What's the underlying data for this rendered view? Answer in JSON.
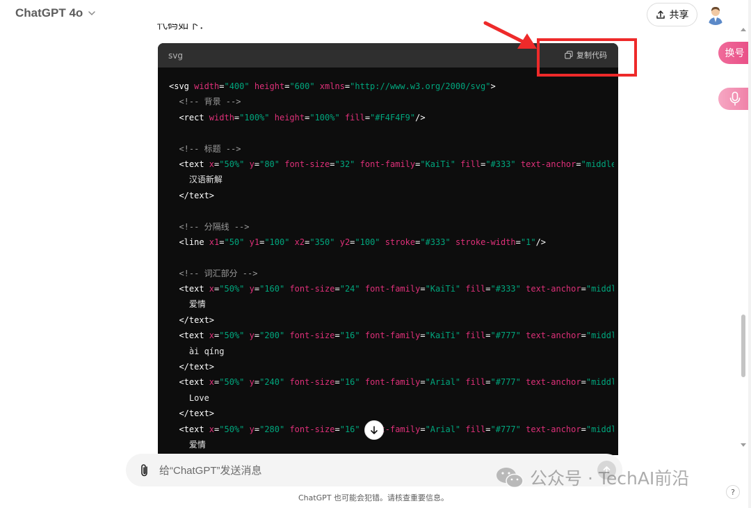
{
  "header": {
    "model_name": "ChatGPT 4o",
    "share_label": "共享"
  },
  "message": {
    "cut_text": "代码如下："
  },
  "code_block": {
    "language": "svg",
    "copy_label": "复制代码",
    "lines": [
      [
        {
          "c": "t-tag",
          "t": "<svg "
        },
        {
          "c": "t-attr",
          "t": "width"
        },
        {
          "c": "t-tag",
          "t": "="
        },
        {
          "c": "t-val",
          "t": "\"400\""
        },
        {
          "c": "t-tag",
          "t": " "
        },
        {
          "c": "t-attr",
          "t": "height"
        },
        {
          "c": "t-tag",
          "t": "="
        },
        {
          "c": "t-val",
          "t": "\"600\""
        },
        {
          "c": "t-tag",
          "t": " "
        },
        {
          "c": "t-attr",
          "t": "xmlns"
        },
        {
          "c": "t-tag",
          "t": "="
        },
        {
          "c": "t-val",
          "t": "\"http://www.w3.org/2000/svg\""
        },
        {
          "c": "t-tag",
          "t": ">"
        }
      ],
      [
        {
          "c": "t-com",
          "t": "  <!-- 背景 -->"
        }
      ],
      [
        {
          "c": "t-tag",
          "t": "  <rect "
        },
        {
          "c": "t-attr",
          "t": "width"
        },
        {
          "c": "t-tag",
          "t": "="
        },
        {
          "c": "t-val",
          "t": "\"100%\""
        },
        {
          "c": "t-tag",
          "t": " "
        },
        {
          "c": "t-attr",
          "t": "height"
        },
        {
          "c": "t-tag",
          "t": "="
        },
        {
          "c": "t-val",
          "t": "\"100%\""
        },
        {
          "c": "t-tag",
          "t": " "
        },
        {
          "c": "t-attr",
          "t": "fill"
        },
        {
          "c": "t-tag",
          "t": "="
        },
        {
          "c": "t-val",
          "t": "\"#F4F4F9\""
        },
        {
          "c": "t-tag",
          "t": "/>"
        }
      ],
      [
        {
          "c": "t-txt",
          "t": ""
        }
      ],
      [
        {
          "c": "t-com",
          "t": "  <!-- 标题 -->"
        }
      ],
      [
        {
          "c": "t-tag",
          "t": "  <text "
        },
        {
          "c": "t-attr",
          "t": "x"
        },
        {
          "c": "t-tag",
          "t": "="
        },
        {
          "c": "t-val",
          "t": "\"50%\""
        },
        {
          "c": "t-tag",
          "t": " "
        },
        {
          "c": "t-attr",
          "t": "y"
        },
        {
          "c": "t-tag",
          "t": "="
        },
        {
          "c": "t-val",
          "t": "\"80\""
        },
        {
          "c": "t-tag",
          "t": " "
        },
        {
          "c": "t-attr",
          "t": "font-size"
        },
        {
          "c": "t-tag",
          "t": "="
        },
        {
          "c": "t-val",
          "t": "\"32\""
        },
        {
          "c": "t-tag",
          "t": " "
        },
        {
          "c": "t-attr",
          "t": "font-family"
        },
        {
          "c": "t-tag",
          "t": "="
        },
        {
          "c": "t-val",
          "t": "\"KaiTi\""
        },
        {
          "c": "t-tag",
          "t": " "
        },
        {
          "c": "t-attr",
          "t": "fill"
        },
        {
          "c": "t-tag",
          "t": "="
        },
        {
          "c": "t-val",
          "t": "\"#333\""
        },
        {
          "c": "t-tag",
          "t": " "
        },
        {
          "c": "t-attr",
          "t": "text-anchor"
        },
        {
          "c": "t-tag",
          "t": "="
        },
        {
          "c": "t-val",
          "t": "\"middle\""
        },
        {
          "c": "t-tag",
          "t": ">"
        }
      ],
      [
        {
          "c": "t-txt",
          "t": "    汉语新解"
        }
      ],
      [
        {
          "c": "t-tag",
          "t": "  </text>"
        }
      ],
      [
        {
          "c": "t-txt",
          "t": ""
        }
      ],
      [
        {
          "c": "t-com",
          "t": "  <!-- 分隔线 -->"
        }
      ],
      [
        {
          "c": "t-tag",
          "t": "  <line "
        },
        {
          "c": "t-attr",
          "t": "x1"
        },
        {
          "c": "t-tag",
          "t": "="
        },
        {
          "c": "t-val",
          "t": "\"50\""
        },
        {
          "c": "t-tag",
          "t": " "
        },
        {
          "c": "t-attr",
          "t": "y1"
        },
        {
          "c": "t-tag",
          "t": "="
        },
        {
          "c": "t-val",
          "t": "\"100\""
        },
        {
          "c": "t-tag",
          "t": " "
        },
        {
          "c": "t-attr",
          "t": "x2"
        },
        {
          "c": "t-tag",
          "t": "="
        },
        {
          "c": "t-val",
          "t": "\"350\""
        },
        {
          "c": "t-tag",
          "t": " "
        },
        {
          "c": "t-attr",
          "t": "y2"
        },
        {
          "c": "t-tag",
          "t": "="
        },
        {
          "c": "t-val",
          "t": "\"100\""
        },
        {
          "c": "t-tag",
          "t": " "
        },
        {
          "c": "t-attr",
          "t": "stroke"
        },
        {
          "c": "t-tag",
          "t": "="
        },
        {
          "c": "t-val",
          "t": "\"#333\""
        },
        {
          "c": "t-tag",
          "t": " "
        },
        {
          "c": "t-attr",
          "t": "stroke-width"
        },
        {
          "c": "t-tag",
          "t": "="
        },
        {
          "c": "t-val",
          "t": "\"1\""
        },
        {
          "c": "t-tag",
          "t": "/>"
        }
      ],
      [
        {
          "c": "t-txt",
          "t": ""
        }
      ],
      [
        {
          "c": "t-com",
          "t": "  <!-- 词汇部分 -->"
        }
      ],
      [
        {
          "c": "t-tag",
          "t": "  <text "
        },
        {
          "c": "t-attr",
          "t": "x"
        },
        {
          "c": "t-tag",
          "t": "="
        },
        {
          "c": "t-val",
          "t": "\"50%\""
        },
        {
          "c": "t-tag",
          "t": " "
        },
        {
          "c": "t-attr",
          "t": "y"
        },
        {
          "c": "t-tag",
          "t": "="
        },
        {
          "c": "t-val",
          "t": "\"160\""
        },
        {
          "c": "t-tag",
          "t": " "
        },
        {
          "c": "t-attr",
          "t": "font-size"
        },
        {
          "c": "t-tag",
          "t": "="
        },
        {
          "c": "t-val",
          "t": "\"24\""
        },
        {
          "c": "t-tag",
          "t": " "
        },
        {
          "c": "t-attr",
          "t": "font-family"
        },
        {
          "c": "t-tag",
          "t": "="
        },
        {
          "c": "t-val",
          "t": "\"KaiTi\""
        },
        {
          "c": "t-tag",
          "t": " "
        },
        {
          "c": "t-attr",
          "t": "fill"
        },
        {
          "c": "t-tag",
          "t": "="
        },
        {
          "c": "t-val",
          "t": "\"#333\""
        },
        {
          "c": "t-tag",
          "t": " "
        },
        {
          "c": "t-attr",
          "t": "text-anchor"
        },
        {
          "c": "t-tag",
          "t": "="
        },
        {
          "c": "t-val",
          "t": "\"middle\""
        }
      ],
      [
        {
          "c": "t-txt",
          "t": "    爱情"
        }
      ],
      [
        {
          "c": "t-tag",
          "t": "  </text>"
        }
      ],
      [
        {
          "c": "t-tag",
          "t": "  <text "
        },
        {
          "c": "t-attr",
          "t": "x"
        },
        {
          "c": "t-tag",
          "t": "="
        },
        {
          "c": "t-val",
          "t": "\"50%\""
        },
        {
          "c": "t-tag",
          "t": " "
        },
        {
          "c": "t-attr",
          "t": "y"
        },
        {
          "c": "t-tag",
          "t": "="
        },
        {
          "c": "t-val",
          "t": "\"200\""
        },
        {
          "c": "t-tag",
          "t": " "
        },
        {
          "c": "t-attr",
          "t": "font-size"
        },
        {
          "c": "t-tag",
          "t": "="
        },
        {
          "c": "t-val",
          "t": "\"16\""
        },
        {
          "c": "t-tag",
          "t": " "
        },
        {
          "c": "t-attr",
          "t": "font-family"
        },
        {
          "c": "t-tag",
          "t": "="
        },
        {
          "c": "t-val",
          "t": "\"KaiTi\""
        },
        {
          "c": "t-tag",
          "t": " "
        },
        {
          "c": "t-attr",
          "t": "fill"
        },
        {
          "c": "t-tag",
          "t": "="
        },
        {
          "c": "t-val",
          "t": "\"#777\""
        },
        {
          "c": "t-tag",
          "t": " "
        },
        {
          "c": "t-attr",
          "t": "text-anchor"
        },
        {
          "c": "t-tag",
          "t": "="
        },
        {
          "c": "t-val",
          "t": "\"middle\""
        }
      ],
      [
        {
          "c": "t-txt",
          "t": "    ài qíng"
        }
      ],
      [
        {
          "c": "t-tag",
          "t": "  </text>"
        }
      ],
      [
        {
          "c": "t-tag",
          "t": "  <text "
        },
        {
          "c": "t-attr",
          "t": "x"
        },
        {
          "c": "t-tag",
          "t": "="
        },
        {
          "c": "t-val",
          "t": "\"50%\""
        },
        {
          "c": "t-tag",
          "t": " "
        },
        {
          "c": "t-attr",
          "t": "y"
        },
        {
          "c": "t-tag",
          "t": "="
        },
        {
          "c": "t-val",
          "t": "\"240\""
        },
        {
          "c": "t-tag",
          "t": " "
        },
        {
          "c": "t-attr",
          "t": "font-size"
        },
        {
          "c": "t-tag",
          "t": "="
        },
        {
          "c": "t-val",
          "t": "\"16\""
        },
        {
          "c": "t-tag",
          "t": " "
        },
        {
          "c": "t-attr",
          "t": "font-family"
        },
        {
          "c": "t-tag",
          "t": "="
        },
        {
          "c": "t-val",
          "t": "\"Arial\""
        },
        {
          "c": "t-tag",
          "t": " "
        },
        {
          "c": "t-attr",
          "t": "fill"
        },
        {
          "c": "t-tag",
          "t": "="
        },
        {
          "c": "t-val",
          "t": "\"#777\""
        },
        {
          "c": "t-tag",
          "t": " "
        },
        {
          "c": "t-attr",
          "t": "text-anchor"
        },
        {
          "c": "t-tag",
          "t": "="
        },
        {
          "c": "t-val",
          "t": "\"middle\""
        }
      ],
      [
        {
          "c": "t-txt",
          "t": "    Love"
        }
      ],
      [
        {
          "c": "t-tag",
          "t": "  </text>"
        }
      ],
      [
        {
          "c": "t-tag",
          "t": "  <text "
        },
        {
          "c": "t-attr",
          "t": "x"
        },
        {
          "c": "t-tag",
          "t": "="
        },
        {
          "c": "t-val",
          "t": "\"50%\""
        },
        {
          "c": "t-tag",
          "t": " "
        },
        {
          "c": "t-attr",
          "t": "y"
        },
        {
          "c": "t-tag",
          "t": "="
        },
        {
          "c": "t-val",
          "t": "\"280\""
        },
        {
          "c": "t-tag",
          "t": " "
        },
        {
          "c": "t-attr",
          "t": "font-size"
        },
        {
          "c": "t-tag",
          "t": "="
        },
        {
          "c": "t-val",
          "t": "\"16\""
        },
        {
          "c": "t-tag",
          "t": " "
        },
        {
          "c": "t-attr",
          "t": "font-family"
        },
        {
          "c": "t-tag",
          "t": "="
        },
        {
          "c": "t-val",
          "t": "\"Arial\""
        },
        {
          "c": "t-tag",
          "t": " "
        },
        {
          "c": "t-attr",
          "t": "fill"
        },
        {
          "c": "t-tag",
          "t": "="
        },
        {
          "c": "t-val",
          "t": "\"#777\""
        },
        {
          "c": "t-tag",
          "t": " "
        },
        {
          "c": "t-attr",
          "t": "text-anchor"
        },
        {
          "c": "t-tag",
          "t": "="
        },
        {
          "c": "t-val",
          "t": "\"middle\""
        }
      ],
      [
        {
          "c": "t-txt",
          "t": "    爱情"
        }
      ]
    ]
  },
  "composer": {
    "placeholder": "给“ChatGPT”发送消息"
  },
  "footer": {
    "disclaimer": "ChatGPT 也可能会犯错。请核查重要信息。",
    "help_label": "?"
  },
  "side_panel": {
    "swap_label": "换号"
  },
  "watermark": {
    "text": "公众号 · TechAI前沿"
  },
  "colors": {
    "code_bg": "#0d0d0d",
    "code_header": "#2f2f2f",
    "tag": "#ffffff",
    "attribute": "#df3079",
    "value": "#00a67d",
    "comment": "#9a9a9a",
    "annotation_red": "#ee2a2a",
    "side_pill": "#e84e86"
  },
  "icons": {
    "model_chevron": "chevron-down-icon",
    "share": "upload-icon",
    "avatar": "user-avatar",
    "copy": "copy-icon",
    "scroll_down": "arrow-down-icon",
    "attach": "paperclip-icon",
    "send": "arrow-up-icon",
    "mic": "microphone-icon",
    "wechat": "wechat-icon"
  }
}
